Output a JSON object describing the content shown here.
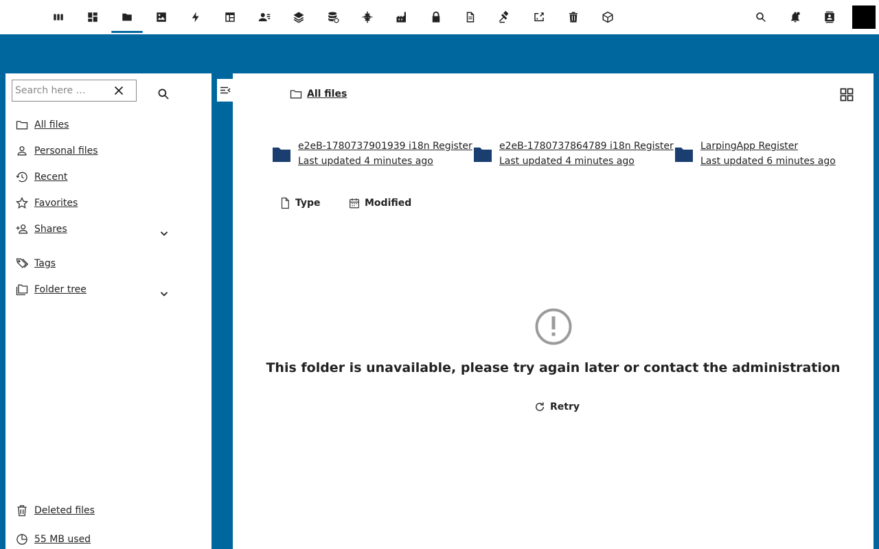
{
  "header": {
    "apps": [
      {
        "icon": "columns-icon",
        "name": "app-icon-columns"
      },
      {
        "icon": "dashboard-icon",
        "name": "app-icon-dashboard"
      },
      {
        "icon": "folder-icon",
        "name": "app-icon-files",
        "active": true
      },
      {
        "icon": "image-icon",
        "name": "app-icon-photos"
      },
      {
        "icon": "bolt-icon",
        "name": "app-icon-activity"
      },
      {
        "icon": "table-icon",
        "name": "app-icon-tables"
      },
      {
        "icon": "contacts-icon",
        "name": "app-icon-contacts"
      },
      {
        "icon": "layers-icon",
        "name": "app-icon-layers"
      },
      {
        "icon": "database-sync-icon",
        "name": "app-icon-database"
      },
      {
        "icon": "plugin-icon",
        "name": "app-icon-integrations"
      },
      {
        "icon": "factory-icon",
        "name": "app-icon-factory"
      },
      {
        "icon": "lock-icon",
        "name": "app-icon-passwords"
      },
      {
        "icon": "document-icon",
        "name": "app-icon-documents"
      },
      {
        "icon": "gavel-icon",
        "name": "app-icon-legal"
      },
      {
        "icon": "code-icon",
        "name": "app-icon-code"
      },
      {
        "icon": "trash-icon",
        "name": "app-icon-trash"
      },
      {
        "icon": "cube-icon",
        "name": "app-icon-cube"
      }
    ],
    "right": [
      "search-icon",
      "bell-icon",
      "contact-card-icon"
    ]
  },
  "sidebar": {
    "search_placeholder": "Search here …",
    "items": [
      {
        "label": "All files",
        "icon": "folder-outline-icon"
      },
      {
        "label": "Personal files",
        "icon": "account-icon"
      },
      {
        "label": "Recent",
        "icon": "history-icon"
      },
      {
        "label": "Favorites",
        "icon": "star-icon"
      },
      {
        "label": "Shares",
        "icon": "share-user-icon"
      },
      {
        "label": "Tags",
        "icon": "tag-icon"
      },
      {
        "label": "Folder tree",
        "icon": "folder-tree-icon"
      }
    ],
    "footer": {
      "deleted": "Deleted files",
      "quota": "55 MB used"
    }
  },
  "main": {
    "breadcrumb": "All files",
    "folders": [
      {
        "name": "e2eB-1780737901939 i18n Register",
        "updated": "Last updated 4 minutes ago"
      },
      {
        "name": "e2eB-1780737864789 i18n Register",
        "updated": "Last updated 4 minutes ago"
      },
      {
        "name": "LarpingApp Register",
        "updated": "Last updated 6 minutes ago"
      }
    ],
    "sort": {
      "type": "Type",
      "modified": "Modified"
    },
    "empty_message": "This folder is unavailable, please try again later or contact the administration",
    "retry_label": "Retry"
  },
  "colors": {
    "brand": "#00679e",
    "folder": "#1a3e6f",
    "empty_icon": "#9b9b9b"
  }
}
